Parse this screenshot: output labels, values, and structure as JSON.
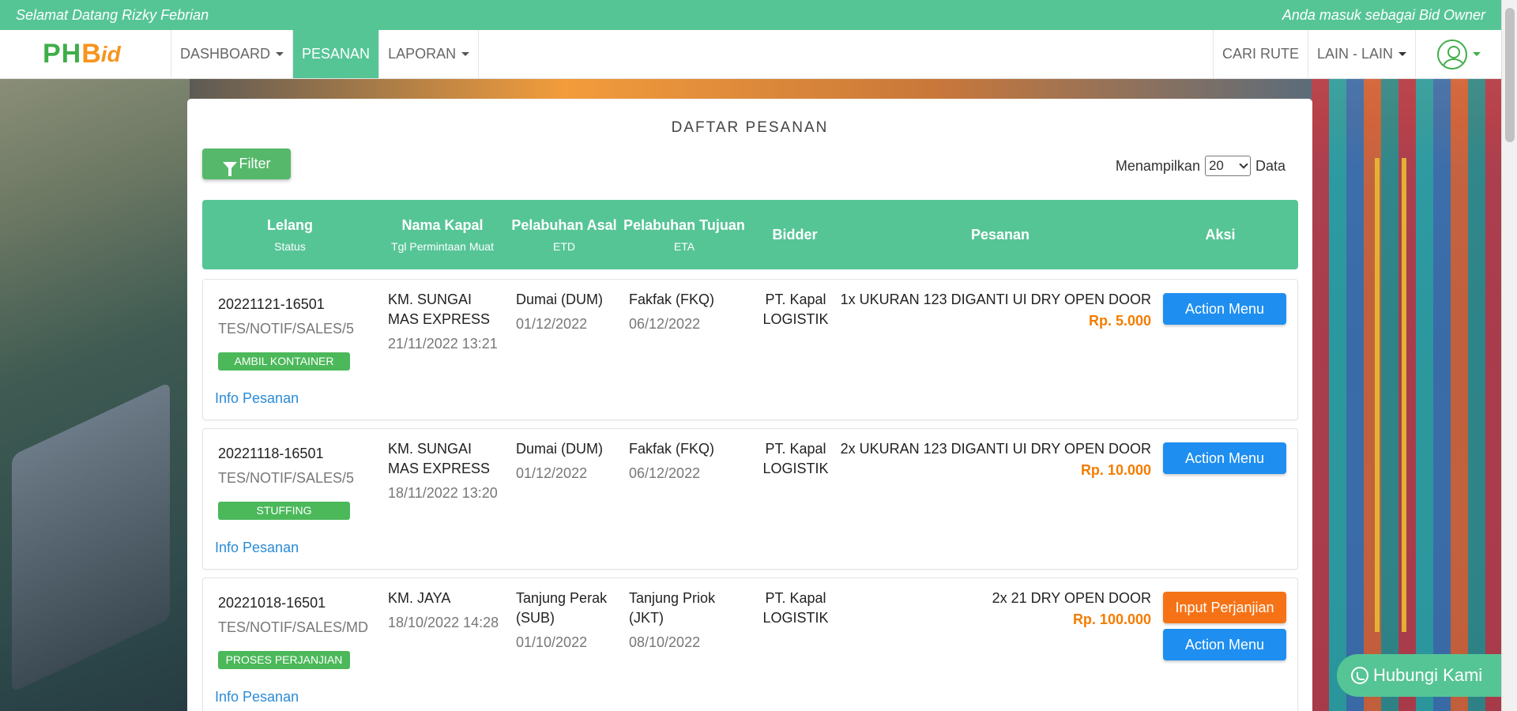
{
  "topbar": {
    "welcome": "Selamat Datang Rizky Febrian",
    "role": "Anda masuk sebagai Bid Owner"
  },
  "logo": {
    "ph": "PH",
    "b": "B",
    "id": "id"
  },
  "nav": {
    "dashboard": "DASHBOARD",
    "pesanan": "PESANAN",
    "laporan": "LAPORAN",
    "cari_rute": "CARI RUTE",
    "lain_lain": "LAIN - LAIN"
  },
  "card": {
    "title": "DAFTAR PESANAN",
    "filter_label": "Filter",
    "show_prefix": "Menampilkan",
    "show_value": "20",
    "show_suffix": "Data"
  },
  "table": {
    "headers": [
      {
        "main": "Lelang",
        "sub": "Status"
      },
      {
        "main": "Nama Kapal",
        "sub": "Tgl Permintaan Muat"
      },
      {
        "main": "Pelabuhan Asal",
        "sub": "ETD"
      },
      {
        "main": "Pelabuhan Tujuan",
        "sub": "ETA"
      },
      {
        "main": "Bidder",
        "sub": ""
      },
      {
        "main": "Pesanan",
        "sub": ""
      },
      {
        "main": "Aksi",
        "sub": ""
      }
    ],
    "rows": [
      {
        "lelang_id": "20221121-16501",
        "ref": "TES/NOTIF/SALES/5",
        "status": "AMBIL KONTAINER",
        "info": "Info Pesanan",
        "kapal_line1": "KM. SUNGAI",
        "kapal_line2": "MAS EXPRESS",
        "tgl_muat": "21/11/2022 13:21",
        "asal_line1": "Dumai (DUM)",
        "asal_line2": "",
        "etd": "01/12/2022",
        "tujuan_line1": "Fakfak (FKQ)",
        "tujuan_line2": "",
        "eta": "06/12/2022",
        "bidder_line1": "PT. Kapal",
        "bidder_line2": "LOGISTIK",
        "pesanan": "1x UKURAN 123 DIGANTI UI DRY OPEN DOOR",
        "harga": "Rp. 5.000",
        "action": "Action Menu"
      },
      {
        "lelang_id": "20221118-16501",
        "ref": "TES/NOTIF/SALES/5",
        "status": "STUFFING",
        "info": "Info Pesanan",
        "kapal_line1": "KM. SUNGAI",
        "kapal_line2": "MAS EXPRESS",
        "tgl_muat": "18/11/2022 13:20",
        "asal_line1": "Dumai (DUM)",
        "asal_line2": "",
        "etd": "01/12/2022",
        "tujuan_line1": "Fakfak (FKQ)",
        "tujuan_line2": "",
        "eta": "06/12/2022",
        "bidder_line1": "PT. Kapal",
        "bidder_line2": "LOGISTIK",
        "pesanan": "2x UKURAN 123 DIGANTI UI DRY OPEN DOOR",
        "harga": "Rp. 10.000",
        "action": "Action Menu"
      },
      {
        "lelang_id": "20221018-16501",
        "ref": "TES/NOTIF/SALES/MD",
        "status": "PROSES PERJANJIAN",
        "info": "Info Pesanan",
        "kapal_line1": "KM. JAYA",
        "kapal_line2": "",
        "tgl_muat": "18/10/2022 14:28",
        "asal_line1": "Tanjung Perak",
        "asal_line2": "(SUB)",
        "etd": "01/10/2022",
        "tujuan_line1": "Tanjung Priok",
        "tujuan_line2": "(JKT)",
        "eta": "08/10/2022",
        "bidder_line1": "PT. Kapal",
        "bidder_line2": "LOGISTIK",
        "pesanan": "2x 21 DRY OPEN DOOR",
        "harga": "Rp. 100.000",
        "action": "Action Menu",
        "extra_action": "Input Perjanjian"
      }
    ]
  },
  "whatsapp": {
    "label": "Hubungi Kami"
  }
}
